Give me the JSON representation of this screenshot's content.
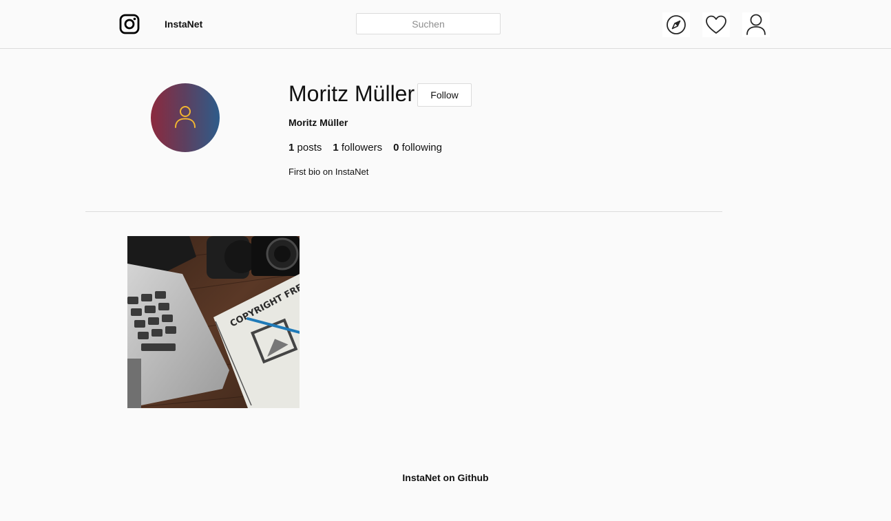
{
  "header": {
    "brand": "InstaNet",
    "search_placeholder": "Suchen",
    "icons": [
      "instagram-logo-icon",
      "compass-icon",
      "heart-icon",
      "user-icon"
    ]
  },
  "profile": {
    "username": "Moritz Müller",
    "follow_label": "Follow",
    "full_name": "Moritz Müller",
    "stats": {
      "posts_count": "1",
      "posts_label": "posts",
      "followers_count": "1",
      "followers_label": "followers",
      "following_count": "0",
      "following_label": "following"
    },
    "bio": "First bio on InstaNet",
    "avatar_colors": [
      "#8c2a3e",
      "#2e5c8a"
    ],
    "avatar_icon_color": "#f2b630"
  },
  "posts": [
    {
      "image_text": "COPYRIGHT FREE IMAGES"
    }
  ],
  "footer": {
    "link_text": "InstaNet on Github"
  }
}
